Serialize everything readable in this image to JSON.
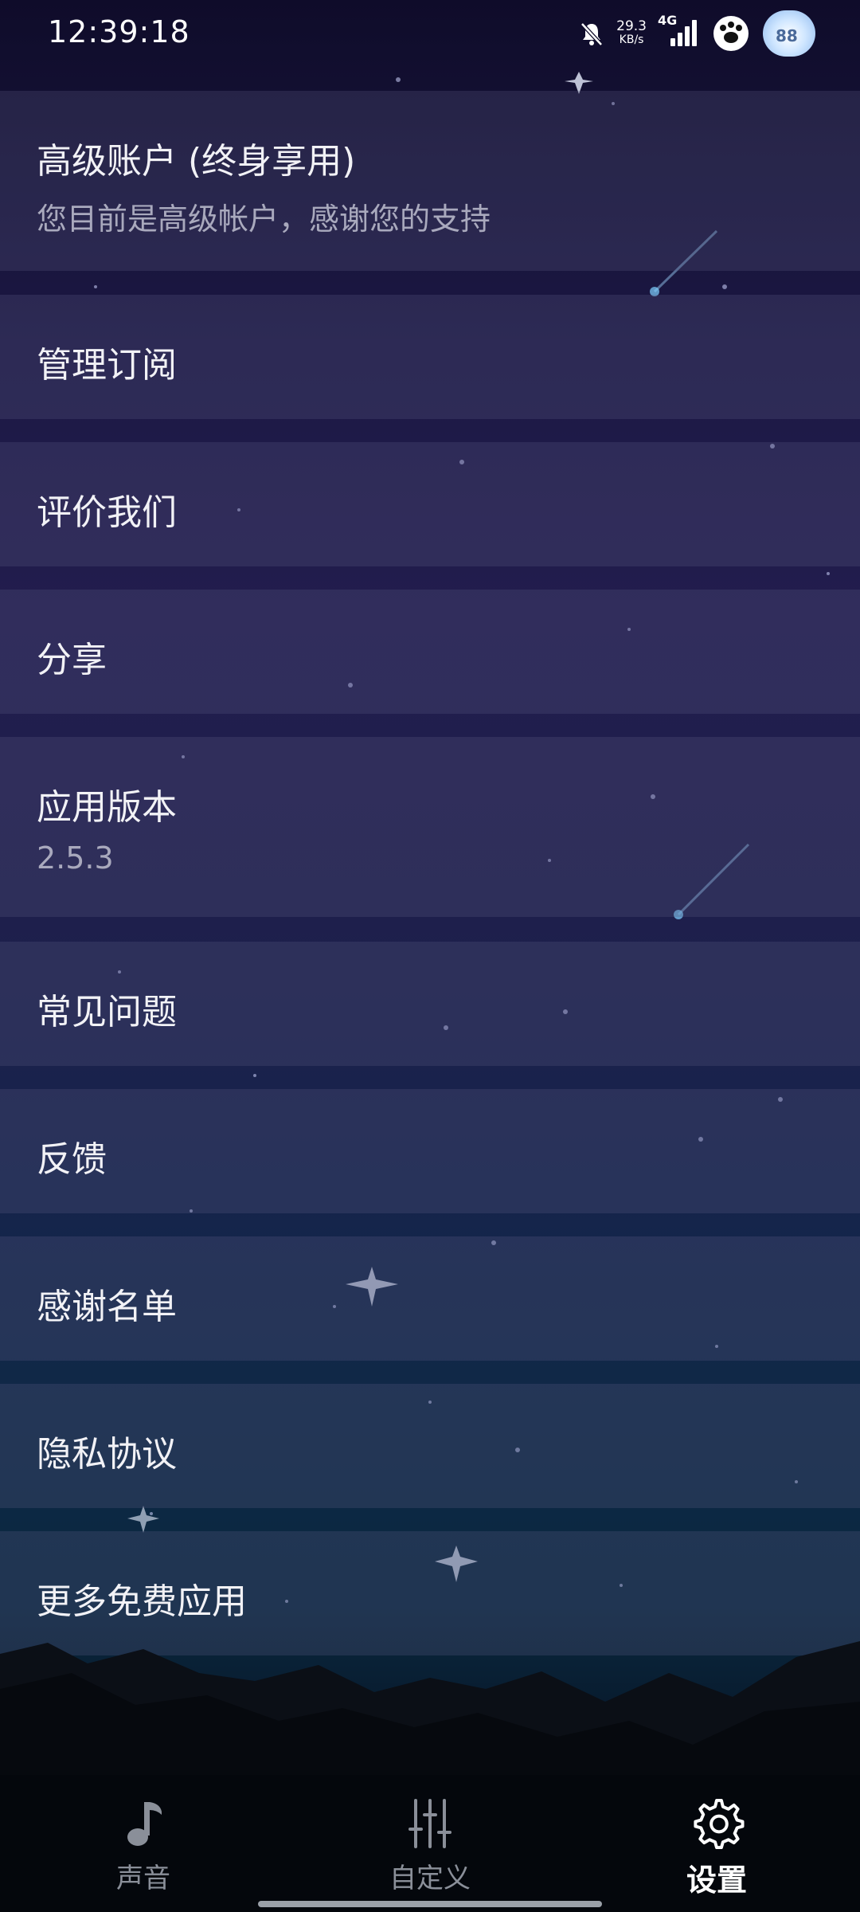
{
  "status_bar": {
    "time": "12:39:18",
    "net_speed_value": "29.3",
    "net_speed_unit": "KB/s",
    "network_type": "4G",
    "avatar_badge": "88"
  },
  "settings": {
    "items": [
      {
        "title": "高级账户 (终身享用)",
        "subtitle": "您目前是高级帐户，感谢您的支持"
      },
      {
        "title": "管理订阅"
      },
      {
        "title": "评价我们"
      },
      {
        "title": "分享"
      },
      {
        "title": "应用版本",
        "subtitle": "2.5.3"
      },
      {
        "title": "常见问题"
      },
      {
        "title": "反馈"
      },
      {
        "title": "感谢名单"
      },
      {
        "title": "隐私协议"
      },
      {
        "title": "更多免费应用"
      }
    ]
  },
  "bottom_nav": {
    "tabs": [
      {
        "label": "声音",
        "icon": "music-note-icon"
      },
      {
        "label": "自定义",
        "icon": "sliders-icon"
      },
      {
        "label": "设置",
        "icon": "gear-icon",
        "active": true
      }
    ]
  },
  "colors": {
    "accent_active": "#ffffff",
    "inactive": "#8a8f99",
    "item_text": "#f2f2f6",
    "item_subtext": "#a9a9bd"
  }
}
